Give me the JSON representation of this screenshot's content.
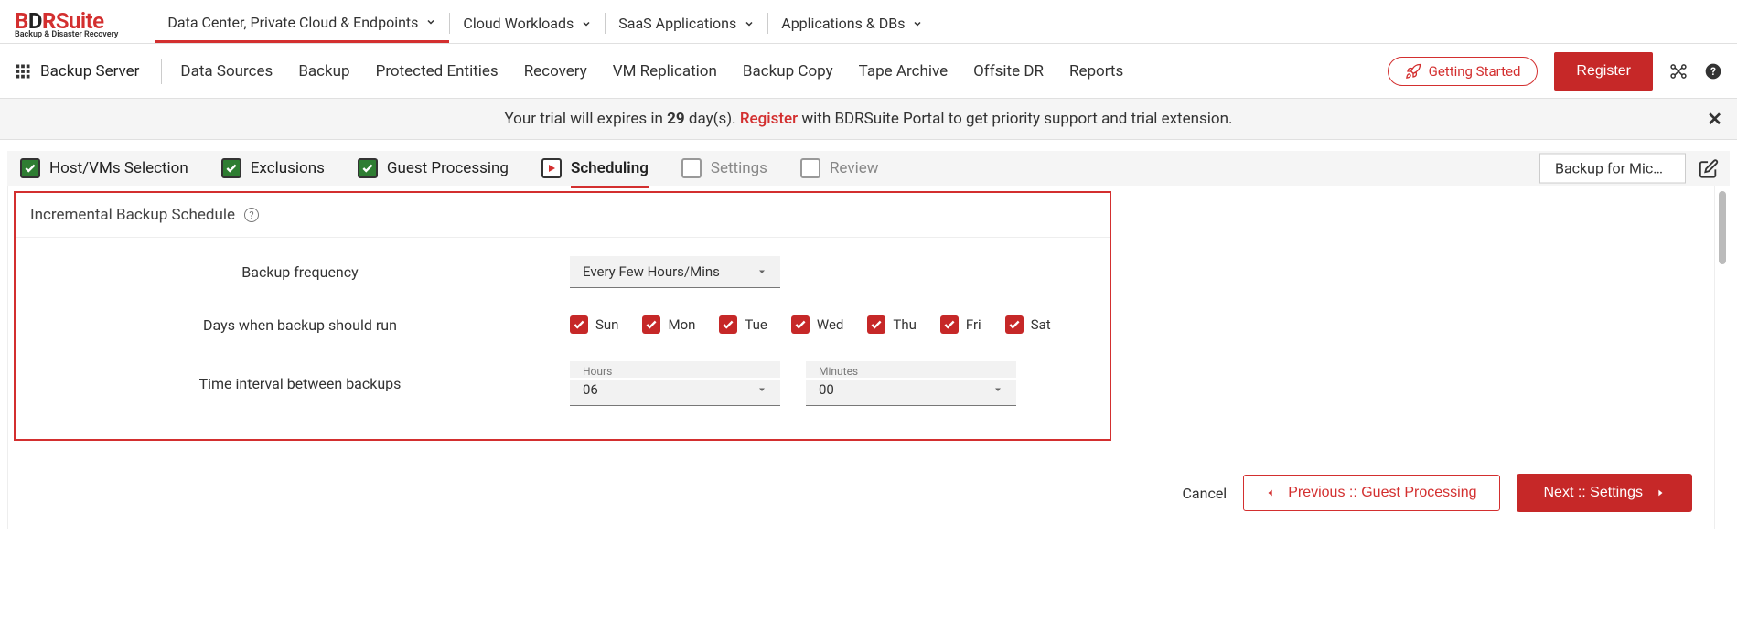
{
  "brand": {
    "name_black": "BDR",
    "name_red": "Suite",
    "tagline": "Backup & Disaster Recovery"
  },
  "nav1": {
    "items": [
      {
        "label": "Data Center, Private Cloud & Endpoints"
      },
      {
        "label": "Cloud Workloads"
      },
      {
        "label": "SaaS Applications"
      },
      {
        "label": "Applications & DBs"
      }
    ]
  },
  "nav2": {
    "server_label": "Backup Server",
    "items": [
      {
        "label": "Data Sources"
      },
      {
        "label": "Backup"
      },
      {
        "label": "Protected Entities"
      },
      {
        "label": "Recovery"
      },
      {
        "label": "VM Replication"
      },
      {
        "label": "Backup Copy"
      },
      {
        "label": "Tape Archive"
      },
      {
        "label": "Offsite DR"
      },
      {
        "label": "Reports"
      }
    ],
    "getting_started": "Getting Started",
    "register": "Register"
  },
  "trial": {
    "prefix": "Your trial will expires in ",
    "days": "29",
    "days_suffix": " day(s). ",
    "register": "Register",
    "suffix": " with BDRSuite Portal to get priority support and trial extension."
  },
  "steps": {
    "items": [
      {
        "label": "Host/VMs Selection",
        "state": "done"
      },
      {
        "label": "Exclusions",
        "state": "done"
      },
      {
        "label": "Guest Processing",
        "state": "done"
      },
      {
        "label": "Scheduling",
        "state": "current"
      },
      {
        "label": "Settings",
        "state": "pending"
      },
      {
        "label": "Review",
        "state": "pending"
      }
    ],
    "job_title": "Backup for Mic…"
  },
  "schedule": {
    "section_title": "Incremental Backup Schedule",
    "frequency_label": "Backup frequency",
    "frequency_value": "Every Few Hours/Mins",
    "days_label": "Days when backup should run",
    "days": [
      {
        "label": "Sun"
      },
      {
        "label": "Mon"
      },
      {
        "label": "Tue"
      },
      {
        "label": "Wed"
      },
      {
        "label": "Thu"
      },
      {
        "label": "Fri"
      },
      {
        "label": "Sat"
      }
    ],
    "interval_label": "Time interval between backups",
    "hours_label": "Hours",
    "hours_value": "06",
    "minutes_label": "Minutes",
    "minutes_value": "00"
  },
  "footer": {
    "cancel": "Cancel",
    "prev": "Previous :: Guest Processing",
    "next": "Next :: Settings"
  }
}
